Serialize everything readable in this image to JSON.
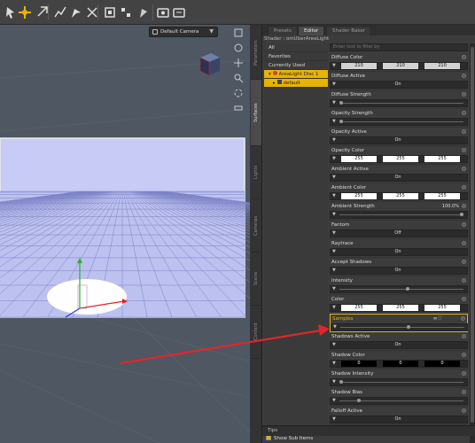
{
  "toolbar": {
    "icons": [
      "select-icon",
      "move-icon",
      "rotate-icon",
      "node-weight-icon",
      "surface-selection-icon",
      "joint-editor-icon",
      "geometry-editor-icon",
      "region-navigator-icon",
      "render-icon",
      "render-settings-icon",
      "spot-render-icon"
    ]
  },
  "viewport": {
    "camera_label": "Default Camera"
  },
  "panel": {
    "vertical_tabs": [
      "Parameters",
      "Surfaces",
      "Lights",
      "Cameras",
      "Scene",
      "Content"
    ],
    "tabs": [
      "Presets",
      "Editor",
      "Shader Baker"
    ],
    "active_tab": "Editor",
    "shader_label": "Shader : omUberAreaLight",
    "filter_placeholder": "Enter text to filter by",
    "tree": {
      "items": [
        "All",
        "Favorites",
        "Currently Used"
      ],
      "selected_item": "AreaLight Disc 1",
      "selected_child": "default"
    },
    "show_sub_items": "Show Sub Items",
    "tips": "Tips"
  },
  "properties": [
    {
      "label": "Diffuse Color",
      "type": "color",
      "values": [
        "210",
        "210",
        "210"
      ],
      "bg": "#d2d2d2"
    },
    {
      "label": "Diffuse Active",
      "type": "toggle",
      "value": "On"
    },
    {
      "label": "Diffuse Strength",
      "type": "slider",
      "pos": 0.0
    },
    {
      "label": "Opacity Strength",
      "type": "slider",
      "pos": 0.0
    },
    {
      "label": "Opacity Active",
      "type": "toggle",
      "value": "On"
    },
    {
      "label": "Opacity Color",
      "type": "color",
      "values": [
        "255",
        "255",
        "255"
      ],
      "bg": "#ffffff"
    },
    {
      "label": "Ambient Active",
      "type": "toggle",
      "value": "On"
    },
    {
      "label": "Ambient Color",
      "type": "color",
      "values": [
        "255",
        "255",
        "255"
      ],
      "bg": "#ffffff"
    },
    {
      "label": "Ambient Strength",
      "type": "slider",
      "pos": 1.0,
      "value": "100.0%"
    },
    {
      "label": "Fantom",
      "type": "toggle",
      "value": "Off"
    },
    {
      "label": "Raytrace",
      "type": "toggle",
      "value": "On"
    },
    {
      "label": "Accept Shadows",
      "type": "toggle",
      "value": "On"
    },
    {
      "label": "Intensity",
      "type": "slider",
      "pos": 0.55
    },
    {
      "label": "Color",
      "type": "color",
      "values": [
        "255",
        "255",
        "255"
      ],
      "bg": "#ffffff"
    },
    {
      "label": "Samples",
      "type": "slider",
      "pos": 0.55,
      "selected": true
    },
    {
      "label": "Shadows Active",
      "type": "toggle",
      "value": "On"
    },
    {
      "label": "Shadow Color",
      "type": "color",
      "values": [
        "0",
        "0",
        "0"
      ],
      "bg": "#000000",
      "dark": true
    },
    {
      "label": "Shadow Intensity",
      "type": "slider",
      "pos": 0.0
    },
    {
      "label": "Shadow Bias",
      "type": "slider",
      "pos": 0.15
    },
    {
      "label": "Falloff Active",
      "type": "toggle",
      "value": "On"
    }
  ],
  "colors": {
    "accent": "#e8b400",
    "arrow": "#e0262a",
    "sky": "#c8cbf5",
    "floor": "#bdc1ef"
  }
}
